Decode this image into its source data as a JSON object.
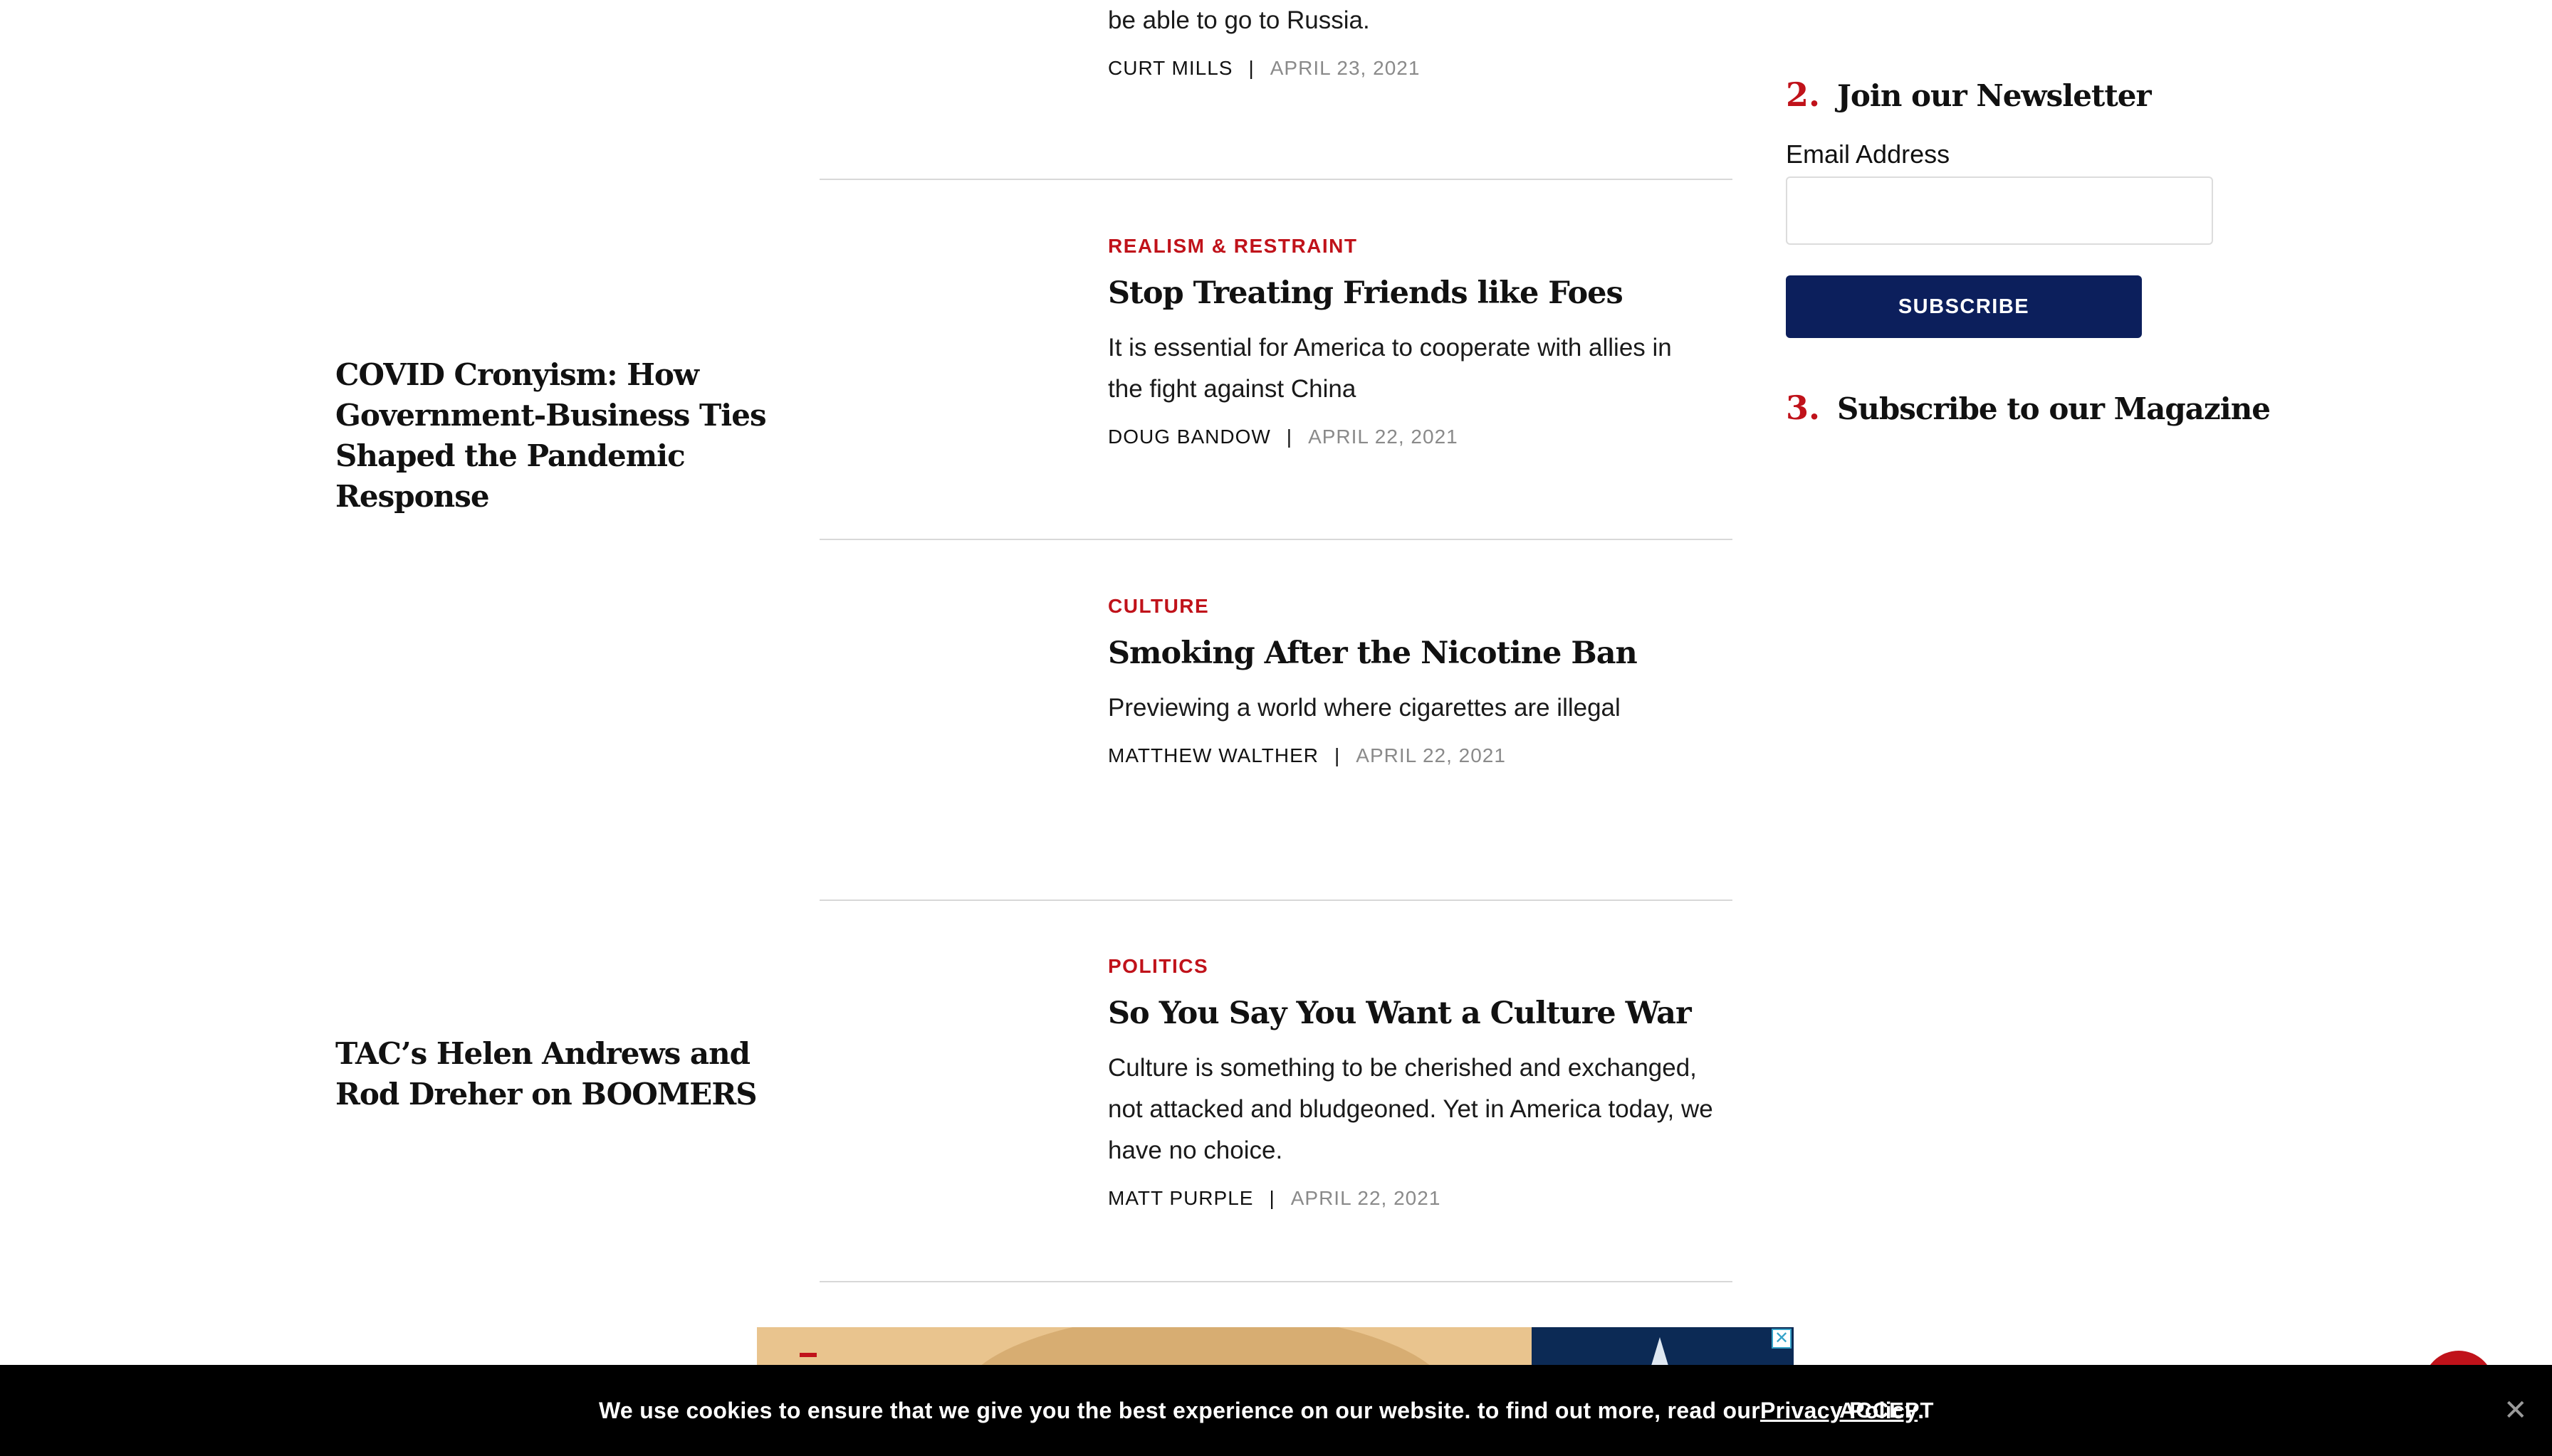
{
  "left_column": {
    "story1_title": "COVID Cronyism: How Government-Business Ties Shaped the Pandemic Response",
    "story2_title": "TAC’s Helen Andrews and Rod Dreher on BOOMERS"
  },
  "articles": [
    {
      "dek_tail": "be able to go to Russia.",
      "author": "CURT MILLS",
      "date": "APRIL 23, 2021"
    },
    {
      "kicker": "REALISM & RESTRAINT",
      "title": "Stop Treating Friends like Foes",
      "dek": "It is essential for America to cooperate with allies in the fight against China",
      "author": "DOUG BANDOW",
      "date": "APRIL 22, 2021"
    },
    {
      "kicker": "CULTURE",
      "title": "Smoking After the Nicotine Ban",
      "dek": "Previewing a world where cigarettes are illegal",
      "author": "MATTHEW WALTHER",
      "date": "APRIL 22, 2021"
    },
    {
      "kicker": "POLITICS",
      "title": "So You Say You Want a Culture War",
      "dek": "Culture is something to be cherished and exchanged, not attacked and bludgeoned. Yet in America today, we have no choice.",
      "author": "MATT PURPLE",
      "date": "APRIL 22, 2021"
    }
  ],
  "byline_separator": "|",
  "sidebar": {
    "newsletter_num": "2.",
    "newsletter_title": "Join our Newsletter",
    "email_label": "Email Address",
    "email_value": "",
    "email_placeholder": "",
    "subscribe_label": "SUBSCRIBE",
    "magazine_num": "3.",
    "magazine_title": "Subscribe to our Magazine"
  },
  "cookie": {
    "message": "We use cookies to ensure that we give you the best experience on our website. to find out more, read our ",
    "policy_link": "Privacy Policy",
    "period": ".",
    "accept_label": "ACCEPT",
    "close_glyph": "✕"
  },
  "ad": {
    "close_glyph": "✕"
  },
  "colors": {
    "accent_red": "#c0121a",
    "navy": "#0c1f5c",
    "date_gray": "#8a8a8a"
  }
}
